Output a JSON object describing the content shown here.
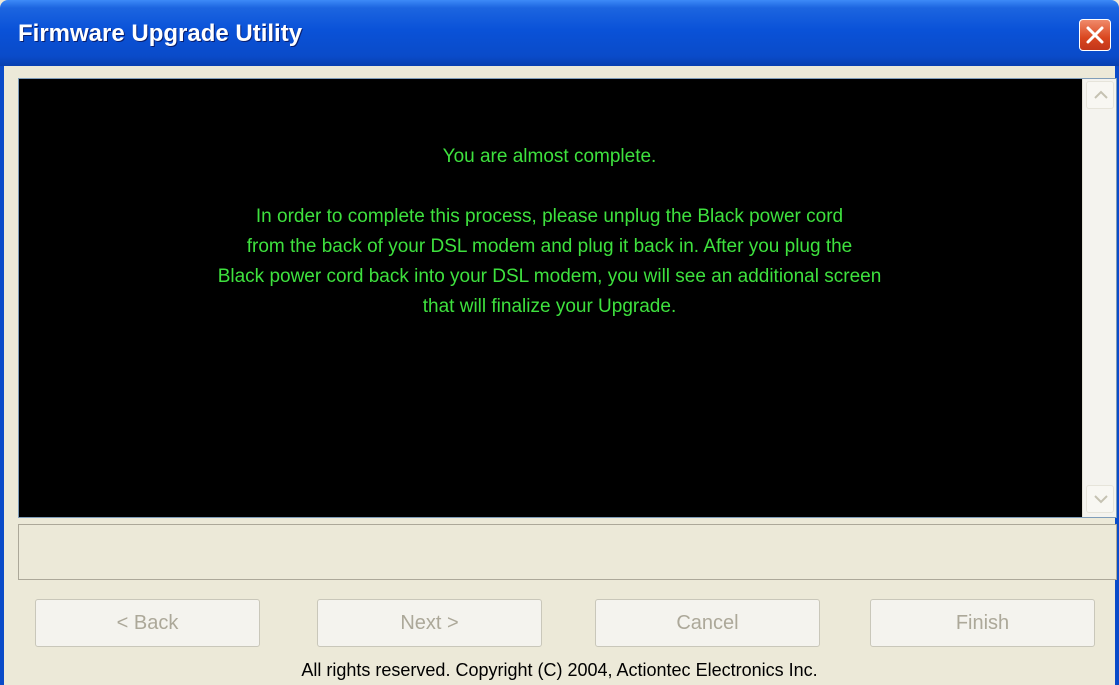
{
  "window": {
    "title": "Firmware Upgrade Utility"
  },
  "message": {
    "lines": [
      "You are almost complete.",
      "In order to complete this process, please unplug the Black power cord",
      "from the back of your DSL modem and plug it back in. After you plug the",
      "Black power cord back into your DSL modem, you will see an additional screen",
      "that will finalize your Upgrade."
    ]
  },
  "status": {
    "text": ""
  },
  "buttons": {
    "back": "< Back",
    "next": "Next >",
    "cancel": "Cancel",
    "finish": "Finish"
  },
  "footer": {
    "copyright": "All rights reserved. Copyright (C) 2004, Actiontec Electronics Inc."
  },
  "colors": {
    "titlebar": "#0a4bc9",
    "message_background": "#000000",
    "message_text": "#3ee13e",
    "dialog_background": "#ece9d8",
    "disabled_text": "#aca899"
  },
  "icons": {
    "close": "close-icon",
    "scroll_up": "chevron-up-icon",
    "scroll_down": "chevron-down-icon"
  }
}
